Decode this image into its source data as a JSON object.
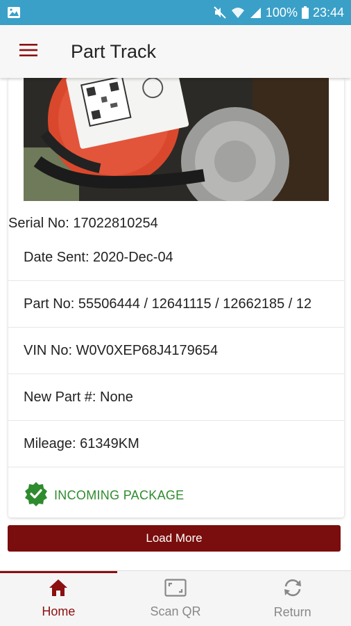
{
  "status_bar": {
    "battery": "100%",
    "time": "23:44",
    "icons": [
      "image-icon",
      "mute-icon",
      "wifi-icon",
      "signal-icon",
      "battery-icon"
    ]
  },
  "app_bar": {
    "title": "Part Track",
    "menu_icon": "hamburger-menu-icon"
  },
  "card": {
    "photo_description_icon": "part-photo",
    "serial": "Serial No: 17022810254",
    "rows": [
      "Date Sent: 2020-Dec-04",
      "Part No: 55506444 / 12641115 / 12662185 / 12",
      "VIN No: W0V0XEP68J4179654",
      "New Part #: None",
      "Mileage: 61349KM"
    ],
    "status": {
      "icon": "verified-check-icon",
      "label": "INCOMING PACKAGE",
      "color": "#2e8b2e"
    }
  },
  "load_more": {
    "label": "Load More"
  },
  "bottom_nav": {
    "items": [
      {
        "label": "Home",
        "icon": "home-icon",
        "active": true
      },
      {
        "label": "Scan QR",
        "icon": "scan-qr-icon",
        "active": false
      },
      {
        "label": "Return",
        "icon": "refresh-icon",
        "active": false
      }
    ]
  },
  "colors": {
    "status_bar": "#3aa0c8",
    "accent": "#7a0d0d",
    "success": "#2e8b2e"
  }
}
